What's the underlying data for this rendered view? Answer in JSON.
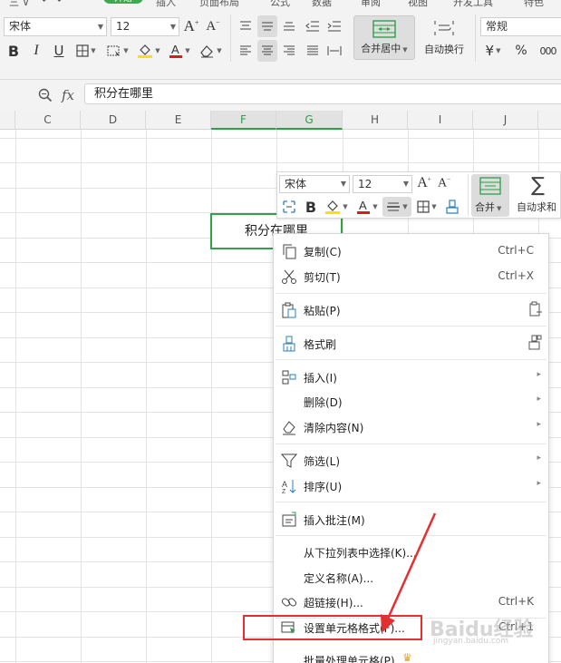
{
  "ribbon": {
    "tab_fragments": [
      "",
      "插入",
      "页面布局",
      "公式",
      "数据",
      "审阅",
      "视图",
      "开发工具",
      "特色"
    ],
    "active_tab": "开始",
    "font_name": "宋体",
    "font_size": "12",
    "merge_label": "合并居中",
    "wrap_label": "自动换行",
    "number_format": "常规",
    "currency_symbol": "¥",
    "percent_symbol": "%",
    "thousands_symbol": "000"
  },
  "formula_bar": {
    "fx_label": "fx",
    "content": "积分在哪里"
  },
  "columns": [
    "C",
    "D",
    "E",
    "F",
    "G",
    "H",
    "I",
    "J"
  ],
  "active_columns": [
    "F",
    "G"
  ],
  "cell": {
    "text": "积分在哪里"
  },
  "mini_toolbar": {
    "font_name": "宋体",
    "font_size": "12",
    "merge_label": "合并",
    "autosum_label": "自动求和"
  },
  "context_menu": {
    "items": [
      {
        "label": "复制(C)",
        "shortcut": "Ctrl+C",
        "icon": "copy-icon"
      },
      {
        "label": "剪切(T)",
        "shortcut": "Ctrl+X",
        "icon": "scissors-icon"
      },
      {
        "label": "粘贴(P)",
        "shortcut": "",
        "icon": "paste-icon"
      },
      {
        "label": "格式刷",
        "shortcut": "",
        "icon": "format-brush-icon"
      },
      {
        "label": "插入(I)",
        "shortcut": "",
        "icon": "insert-icon",
        "submenu": true
      },
      {
        "label": "删除(D)",
        "shortcut": "",
        "icon": "",
        "submenu": true
      },
      {
        "label": "清除内容(N)",
        "shortcut": "",
        "icon": "eraser-icon",
        "submenu": true
      },
      {
        "label": "筛选(L)",
        "shortcut": "",
        "icon": "filter-icon",
        "submenu": true
      },
      {
        "label": "排序(U)",
        "shortcut": "",
        "icon": "sort-icon",
        "submenu": true
      },
      {
        "label": "插入批注(M)",
        "shortcut": "",
        "icon": "comment-icon"
      },
      {
        "label": "从下拉列表中选择(K)...",
        "shortcut": "",
        "icon": ""
      },
      {
        "label": "定义名称(A)...",
        "shortcut": "",
        "icon": ""
      },
      {
        "label": "超链接(H)...",
        "shortcut": "Ctrl+K",
        "icon": "link-icon"
      },
      {
        "label": "设置单元格格式(F)...",
        "shortcut": "Ctrl+1",
        "icon": "format-cells-icon"
      },
      {
        "label": "批量处理单元格(P)",
        "shortcut": "",
        "icon": "",
        "premium": true
      }
    ]
  },
  "annotation": {
    "highlight_color": "#e23030",
    "watermark_text": "Baidu经验",
    "watermark_sub": "jingyan.baidu.com"
  },
  "colors": {
    "accent_green": "#2e9e4a",
    "font_color_red": "#d22020",
    "highlight_yellow": "#f5e400"
  }
}
